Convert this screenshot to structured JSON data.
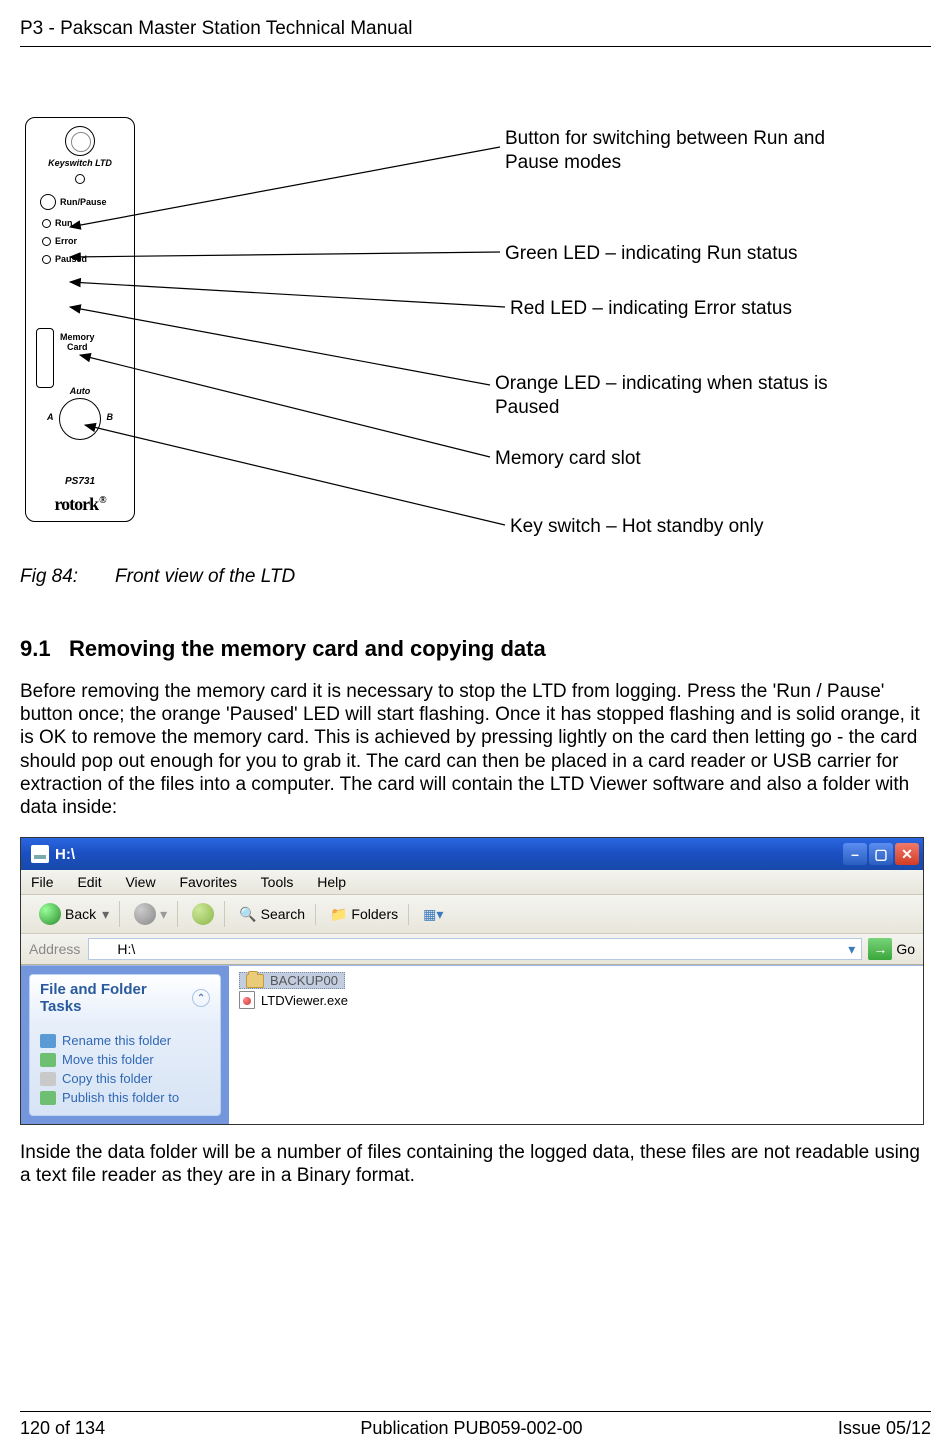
{
  "doc": {
    "header": "P3 - Pakscan Master Station Technical Manual",
    "footer": {
      "page": "120 of 134",
      "publication": "Publication PUB059-002-00",
      "issue": "Issue 05/12"
    }
  },
  "ltd": {
    "keyswitch_label": "Keyswitch LTD",
    "run_pause": "Run/Pause",
    "run": "Run",
    "error": "Error",
    "paused": "Paused",
    "memory": "Memory",
    "card": "Card",
    "auto": "Auto",
    "A": "A",
    "B": "B",
    "ps": "PS731",
    "brand": "rotork"
  },
  "annotations": {
    "a1": "Button for switching between Run and Pause modes",
    "a2": "Green LED – indicating Run status",
    "a3": "Red LED – indicating Error status",
    "a4": "Orange LED – indicating when status is Paused",
    "a5": "Memory card slot",
    "a6": "Key switch – Hot standby only"
  },
  "figure_caption_prefix": "Fig 84:",
  "figure_caption": "Front view of the LTD",
  "section": {
    "number": "9.1",
    "title": "Removing the memory card and copying data"
  },
  "para1": "Before removing the memory card it is necessary to stop the LTD from logging.  Press the 'Run / Pause' button once; the orange 'Paused' LED will start flashing.  Once it has stopped flashing and is solid orange, it is OK to remove the memory card.  This is achieved by pressing lightly on the card then letting go - the card should pop out enough for you to grab it.  The card can then be placed in a card reader or USB carrier for extraction of the files into a computer.  The card will contain the LTD Viewer software and also a folder with data inside:",
  "para2": "Inside the data folder will be a number of files containing the logged data, these files are not readable using a text file reader as they are in a Binary format.",
  "explorer": {
    "title": "H:\\",
    "menu": {
      "file": "File",
      "edit": "Edit",
      "view": "View",
      "favorites": "Favorites",
      "tools": "Tools",
      "help": "Help"
    },
    "toolbar": {
      "back": "Back",
      "search": "Search",
      "folders": "Folders"
    },
    "address_label": "Address",
    "address_value": "H:\\",
    "go": "Go",
    "tasks": {
      "header": "File and Folder Tasks",
      "rename": "Rename this folder",
      "move": "Move this folder",
      "copy": "Copy this folder",
      "publish": "Publish this folder to"
    },
    "files": {
      "folder": "BACKUP00",
      "exe": "LTDViewer.exe"
    }
  }
}
